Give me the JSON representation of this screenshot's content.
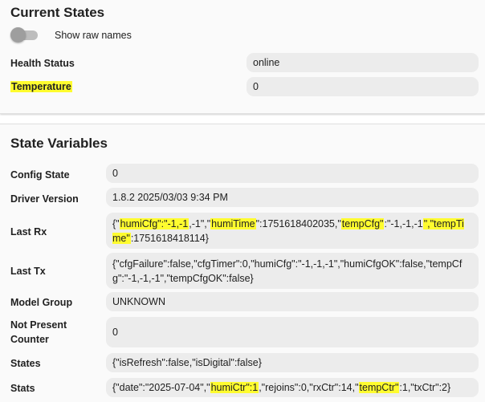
{
  "current_states": {
    "title": "Current States",
    "toggle_label": "Show raw names",
    "toggle_on": false,
    "rows": [
      {
        "label": "Health Status",
        "value": "online"
      },
      {
        "label": "Temperature",
        "value": "0"
      }
    ]
  },
  "state_variables": {
    "title": "State Variables",
    "rows": [
      {
        "label": "Config State",
        "value": "0"
      },
      {
        "label": "Driver Version",
        "value": "1.8.2 2025/03/03 9:34 PM"
      },
      {
        "label": "Last Rx",
        "value": "{\"humiCfg\":\"-1,-1,-1\",\"humiTime\":1751618402035,\"tempCfg\":\"-1,-1,-1\",\"tempTime\":1751618418114}"
      },
      {
        "label": "Last Tx",
        "value": "{\"cfgFailure\":false,\"cfgTimer\":0,\"humiCfg\":\"-1,-1,-1\",\"humiCfgOK\":false,\"tempCfg\":\"-1,-1,-1\",\"tempCfgOK\":false}"
      },
      {
        "label": "Model Group",
        "value": "UNKNOWN"
      },
      {
        "label": "Not Present Counter",
        "value": "0"
      },
      {
        "label": "States",
        "value": "{\"isRefresh\":false,\"isDigital\":false}"
      },
      {
        "label": "Stats",
        "value": "{\"date\":\"2025-07-04\",\"humiCtr\":1,\"rejoins\":0,\"rxCtr\":14,\"tempCtr\":1,\"txCtr\":2}"
      }
    ]
  },
  "colors": {
    "highlight": "#fffc2f",
    "card_background": "#fafafa",
    "value_box": "#ececec"
  }
}
